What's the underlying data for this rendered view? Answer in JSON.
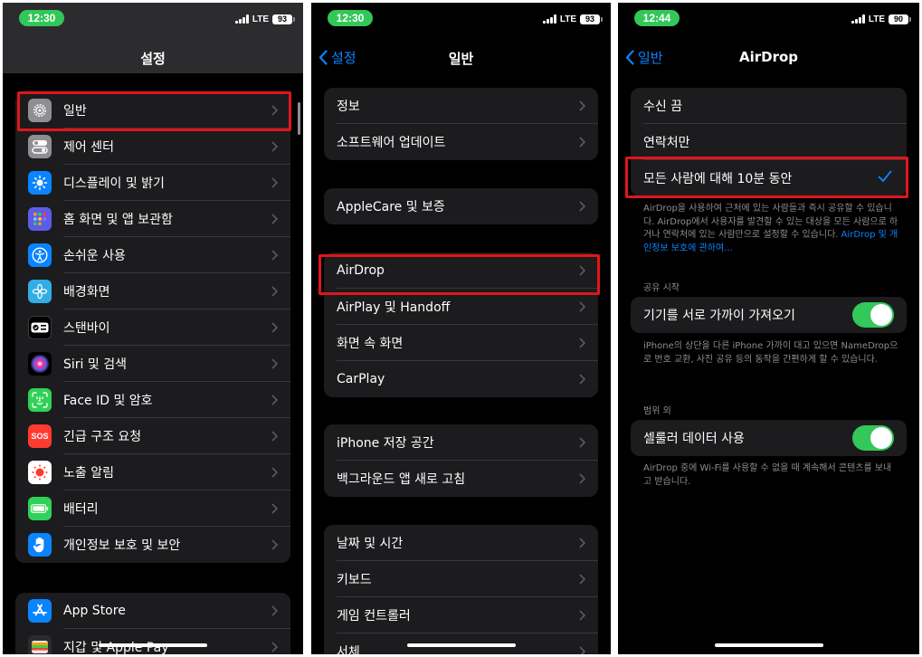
{
  "colors": {
    "accent": "#0a84ff",
    "toggle_on": "#34c759",
    "highlight": "#e0161b"
  },
  "screens": {
    "settings": {
      "status": {
        "time": "12:30",
        "network": "LTE",
        "battery": "93"
      },
      "title": "설정",
      "items": [
        {
          "label": "일반",
          "icon": "gear-icon",
          "color": "#8e8e93"
        },
        {
          "label": "제어 센터",
          "icon": "toggles-icon",
          "color": "#8e8e93"
        },
        {
          "label": "디스플레이 및 밝기",
          "icon": "sun-icon",
          "color": "#0a84ff"
        },
        {
          "label": "홈 화면 및 앱 보관함",
          "icon": "grid-icon",
          "color": "#5e5ce6"
        },
        {
          "label": "손쉬운 사용",
          "icon": "accessibility-icon",
          "color": "#0a84ff"
        },
        {
          "label": "배경화면",
          "icon": "flower-icon",
          "color": "#32ade6"
        },
        {
          "label": "스탠바이",
          "icon": "standby-icon",
          "color": "#000000"
        },
        {
          "label": "Siri 및 검색",
          "icon": "siri-icon",
          "color": "#000000"
        },
        {
          "label": "Face ID 및 암호",
          "icon": "faceid-icon",
          "color": "#30d158"
        },
        {
          "label": "긴급 구조 요청",
          "icon": "sos-icon",
          "color": "#ff3b30",
          "icon_text": "SOS"
        },
        {
          "label": "노출 알림",
          "icon": "exposure-icon",
          "color": "#ffffff"
        },
        {
          "label": "배터리",
          "icon": "battery-icon",
          "color": "#30d158"
        },
        {
          "label": "개인정보 보호 및 보안",
          "icon": "hand-icon",
          "color": "#0a84ff"
        }
      ],
      "items2": [
        {
          "label": "App Store",
          "icon": "appstore-icon",
          "color": "#0a84ff"
        },
        {
          "label": "지갑 및 Apple Pay",
          "icon": "wallet-icon",
          "color": "#2c2c2e"
        }
      ]
    },
    "general": {
      "status": {
        "time": "12:30",
        "network": "LTE",
        "battery": "93"
      },
      "back": "설정",
      "title": "일반",
      "g1": [
        "정보",
        "소프트웨어 업데이트"
      ],
      "g2": [
        "AppleCare 및 보증"
      ],
      "g3": [
        "AirDrop",
        "AirPlay 및 Handoff",
        "화면 속 화면",
        "CarPlay"
      ],
      "g4": [
        "iPhone 저장 공간",
        "백그라운드 앱 새로 고침"
      ],
      "g5": [
        "날짜 및 시간",
        "키보드",
        "게임 컨트롤러",
        "서체"
      ]
    },
    "airdrop": {
      "status": {
        "time": "12:44",
        "network": "LTE",
        "battery": "90"
      },
      "back": "일반",
      "title": "AirDrop",
      "options": [
        "수신 끔",
        "연락처만",
        "모든 사람에 대해 10분 동안"
      ],
      "options_footer": "AirDrop을 사용하여 근처에 있는 사람들과 즉시 공유할 수 있습니다. AirDrop에서 사용자를 발견할 수 있는 대상을 모든 사람으로 하거나 연락처에 있는 사람만으로 설정할 수 있습니다. ",
      "options_footer_link": "AirDrop 및 개인정보 보호에 관하여...",
      "share_header": "공유 시작",
      "bring_label": "기기를 서로 가까이 가져오기",
      "bring_footer": "iPhone의 상단을 다른 iPhone 가까이 대고 있으면 NameDrop으로 번호 교환, 사진 공유 등의 동작을 간편하게 할 수 있습니다.",
      "range_header": "범위 외",
      "cellular_label": "셀룰러 데이터 사용",
      "cellular_footer": "AirDrop 중에 Wi-Fi를 사용할 수 없을 때 계속해서 콘텐츠를 보내고 받습니다."
    }
  }
}
